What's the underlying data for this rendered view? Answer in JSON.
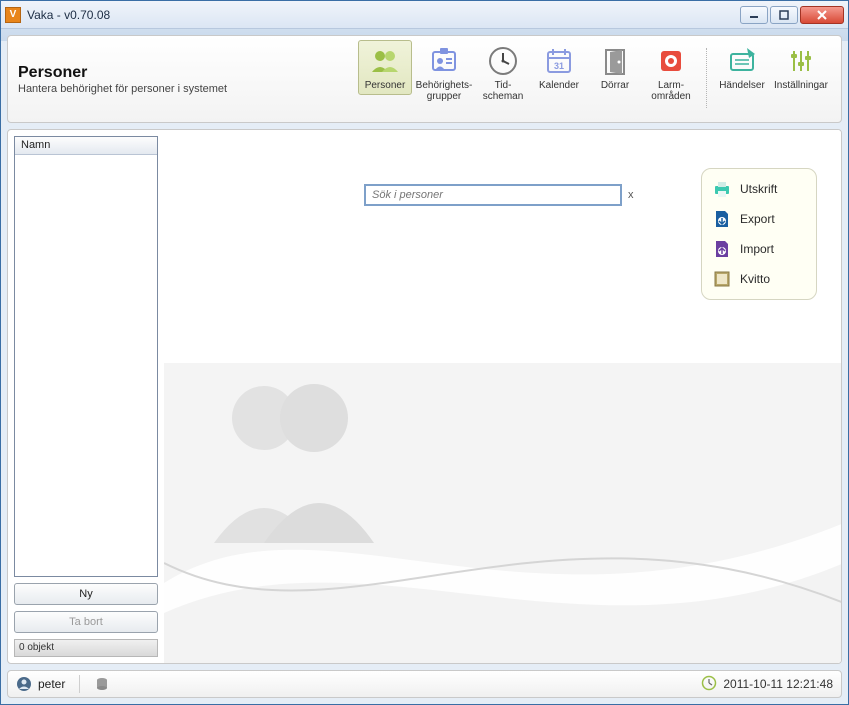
{
  "window": {
    "title": "Vaka - v0.70.08"
  },
  "header": {
    "title": "Personer",
    "subtitle": "Hantera behörighet för personer i systemet"
  },
  "toolbar": {
    "items": [
      {
        "label": "Personer",
        "icon": "personer",
        "active": true
      },
      {
        "label": "Behörighets-\ngrupper",
        "icon": "behorighet"
      },
      {
        "label": "Tid-\nscheman",
        "icon": "clock"
      },
      {
        "label": "Kalender",
        "icon": "calendar"
      },
      {
        "label": "Dörrar",
        "icon": "door"
      },
      {
        "label": "Larm-\nområden",
        "icon": "alarm"
      },
      {
        "label": "Händelser",
        "icon": "events"
      },
      {
        "label": "Inställningar",
        "icon": "settings"
      }
    ]
  },
  "sidebar": {
    "list_header": "Namn",
    "new_label": "Ny",
    "delete_label": "Ta bort",
    "count_label": "0 objekt"
  },
  "search": {
    "placeholder": "Sök i personer",
    "clear": "x"
  },
  "actions": {
    "print": "Utskrift",
    "export": "Export",
    "import": "Import",
    "receipt": "Kvitto"
  },
  "status": {
    "user": "peter",
    "datetime": "2011-10-11 12:21:48"
  }
}
